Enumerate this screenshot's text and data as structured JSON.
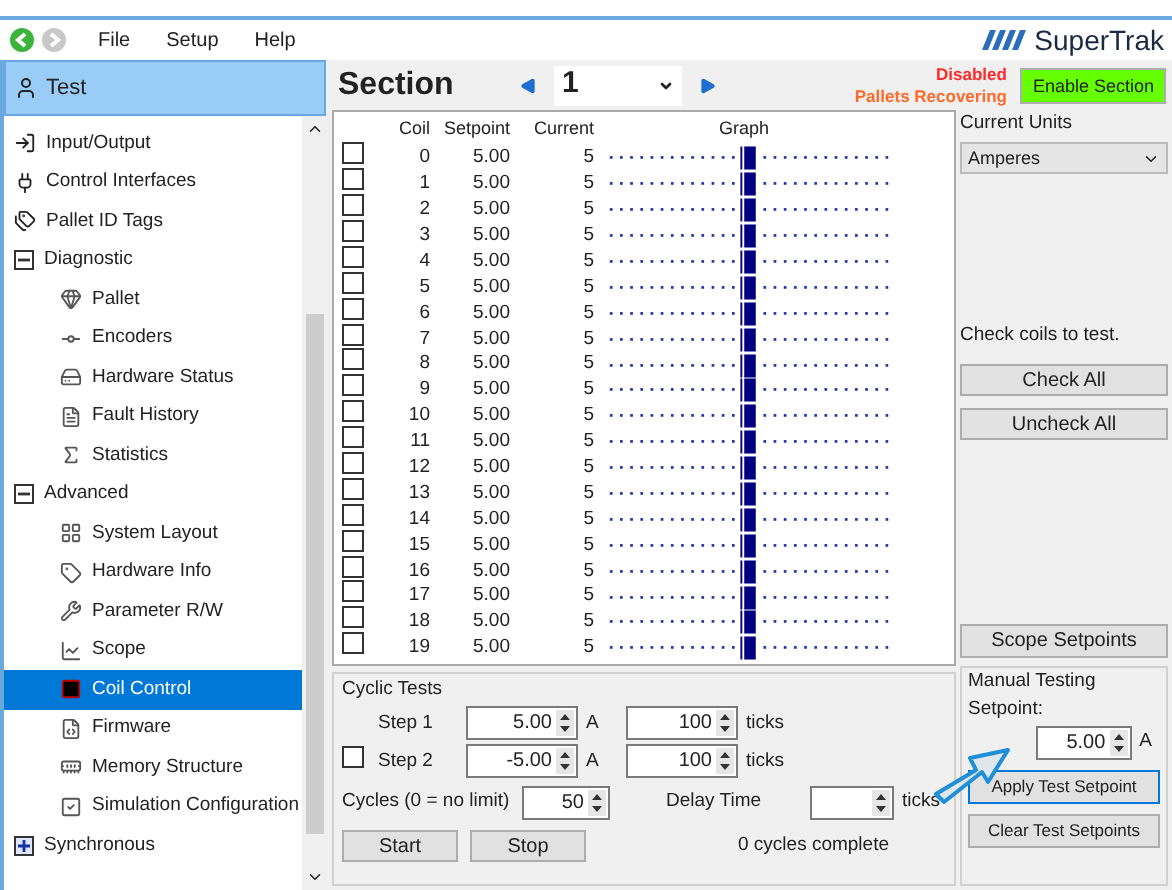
{
  "menu": [
    "File",
    "Setup",
    "Help"
  ],
  "logo": "SuperTrak",
  "sidebar": {
    "header": "Test",
    "items": [
      {
        "kind": "leaf",
        "label": "Input/Output",
        "selected": false
      },
      {
        "kind": "leaf",
        "label": "Control Interfaces",
        "selected": false
      },
      {
        "kind": "leaf",
        "label": "Pallet ID Tags",
        "selected": false
      },
      {
        "kind": "group",
        "label": "Diagnostic",
        "expanded": true,
        "children": [
          {
            "label": "Pallet",
            "selected": false
          },
          {
            "label": "Encoders",
            "selected": false
          },
          {
            "label": "Hardware Status",
            "selected": false
          },
          {
            "label": "Fault History",
            "selected": false
          },
          {
            "label": "Statistics",
            "selected": false
          }
        ]
      },
      {
        "kind": "group",
        "label": "Advanced",
        "expanded": true,
        "children": [
          {
            "label": "System Layout",
            "selected": false
          },
          {
            "label": "Hardware Info",
            "selected": false
          },
          {
            "label": "Parameter R/W",
            "selected": false
          },
          {
            "label": "Scope",
            "selected": false
          },
          {
            "label": "Coil Control",
            "selected": true
          },
          {
            "label": "Firmware",
            "selected": false
          },
          {
            "label": "Memory Structure",
            "selected": false
          },
          {
            "label": "Simulation Configuration",
            "selected": false
          }
        ]
      },
      {
        "kind": "group",
        "label": "Synchronous",
        "expanded": false
      }
    ]
  },
  "section": {
    "label": "Section",
    "value": "1"
  },
  "status": [
    {
      "text": "Disabled",
      "color": "#ff2a2a"
    },
    {
      "text": "Pallets Recovering",
      "color": "#ff6a2a"
    }
  ],
  "enable_button": "Enable Section",
  "table": {
    "columns": [
      "Coil",
      "Setpoint",
      "Current",
      "Graph"
    ],
    "rows": [
      {
        "checked": false,
        "coil": "0",
        "setpoint": "5.00",
        "current": "5"
      },
      {
        "checked": false,
        "coil": "1",
        "setpoint": "5.00",
        "current": "5"
      },
      {
        "checked": false,
        "coil": "2",
        "setpoint": "5.00",
        "current": "5"
      },
      {
        "checked": false,
        "coil": "3",
        "setpoint": "5.00",
        "current": "5"
      },
      {
        "checked": false,
        "coil": "4",
        "setpoint": "5.00",
        "current": "5"
      },
      {
        "checked": false,
        "coil": "5",
        "setpoint": "5.00",
        "current": "5"
      },
      {
        "checked": false,
        "coil": "6",
        "setpoint": "5.00",
        "current": "5"
      },
      {
        "checked": false,
        "coil": "7",
        "setpoint": "5.00",
        "current": "5"
      },
      {
        "checked": false,
        "coil": "8",
        "setpoint": "5.00",
        "current": "5"
      },
      {
        "checked": false,
        "coil": "9",
        "setpoint": "5.00",
        "current": "5"
      },
      {
        "checked": false,
        "coil": "10",
        "setpoint": "5.00",
        "current": "5"
      },
      {
        "checked": false,
        "coil": "11",
        "setpoint": "5.00",
        "current": "5"
      },
      {
        "checked": false,
        "coil": "12",
        "setpoint": "5.00",
        "current": "5"
      },
      {
        "checked": false,
        "coil": "13",
        "setpoint": "5.00",
        "current": "5"
      },
      {
        "checked": false,
        "coil": "14",
        "setpoint": "5.00",
        "current": "5"
      },
      {
        "checked": false,
        "coil": "15",
        "setpoint": "5.00",
        "current": "5"
      },
      {
        "checked": false,
        "coil": "16",
        "setpoint": "5.00",
        "current": "5"
      },
      {
        "checked": false,
        "coil": "17",
        "setpoint": "5.00",
        "current": "5"
      },
      {
        "checked": false,
        "coil": "18",
        "setpoint": "5.00",
        "current": "5"
      },
      {
        "checked": false,
        "coil": "19",
        "setpoint": "5.00",
        "current": "5"
      }
    ]
  },
  "units": {
    "label": "Current Units",
    "value": "Amperes"
  },
  "check_hint": "Check coils to test.",
  "check_buttons": [
    "Check All",
    "Uncheck All"
  ],
  "scope_button": "Scope Setpoints",
  "cyclic": {
    "title": "Cyclic Tests",
    "steps": [
      {
        "kind": "fixed",
        "label": "Step 1",
        "value": "5.00",
        "unit": "A",
        "ticks": "100",
        "ticks_unit": "ticks"
      },
      {
        "kind": "optional",
        "checked": false,
        "label": "Step 2",
        "value": "-5.00",
        "unit": "A",
        "ticks": "100",
        "ticks_unit": "ticks"
      }
    ],
    "cycles_label": "Cycles (0 = no limit)",
    "cycles_value": "50",
    "delay_label": "Delay Time",
    "delay_unit": "ticks",
    "buttons": [
      "Start",
      "Stop"
    ],
    "progress": "0 cycles complete"
  },
  "manual": {
    "title": "Manual Testing",
    "label": "Setpoint:",
    "value": "5.00",
    "unit": "A",
    "buttons": [
      {
        "label": "Apply Test Setpoint",
        "focused": true
      },
      {
        "label": "Clear Test Setpoints",
        "focused": false
      }
    ]
  }
}
